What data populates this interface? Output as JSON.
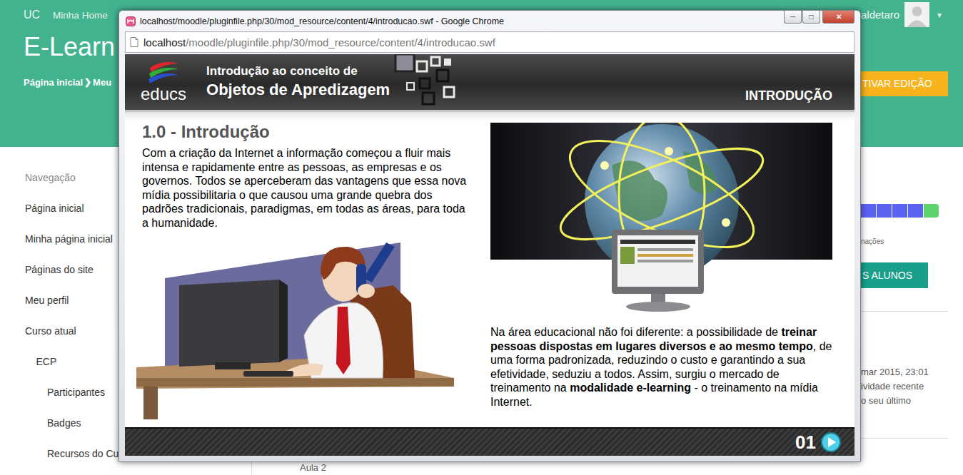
{
  "topbar": {
    "brand": "UC",
    "links": [
      "Minha Home"
    ],
    "user": "aldetaro",
    "caret": "▾"
  },
  "header": {
    "title": "E-Learn",
    "breadcrumb": [
      "Página inicial",
      "Meu"
    ],
    "separator": "❯",
    "edit_button": "TIVAR EDIÇÃO"
  },
  "navigation": {
    "title": "Navegação",
    "items": [
      {
        "label": "Página inicial",
        "depth": 0
      },
      {
        "label": "Minha página inicial",
        "depth": 0
      },
      {
        "label": "Páginas do site",
        "depth": 0
      },
      {
        "label": "Meu perfil",
        "depth": 0
      },
      {
        "label": "Curso atual",
        "depth": 0
      },
      {
        "label": "ECP",
        "depth": 1
      },
      {
        "label": "Participantes",
        "depth": 2
      },
      {
        "label": "Badges",
        "depth": 2
      },
      {
        "label": "Recursos do Cu",
        "depth": 2
      }
    ]
  },
  "course_block": {
    "progress": [
      {
        "color": "#5c62f0"
      },
      {
        "color": "#5c62f0"
      },
      {
        "color": "#5c62f0"
      },
      {
        "color": "#5c62f0"
      },
      {
        "color": "#5fd36b"
      }
    ],
    "caption": "nações",
    "button": "S ALUNOS"
  },
  "recent_activity": {
    "lines": [
      "mar 2015, 23:01",
      "ividade recente",
      "o seu último"
    ]
  },
  "main": {
    "sections": [
      "Aula 2"
    ]
  },
  "popup": {
    "title": "localhost/moodle/pluginfile.php/30/mod_resource/content/4/introducao.swf - Google Chrome",
    "controls": [
      {
        "label": "─",
        "kind": "minimize"
      },
      {
        "label": "□",
        "kind": "maximize"
      },
      {
        "label": "✕",
        "kind": "close"
      }
    ],
    "address": {
      "host": "localhost",
      "path": "/moodle/pluginfile.php/30/mod_resource/content/4/introducao.swf"
    },
    "lesson": {
      "logo": "educs",
      "subtitle": "Introdução ao conceito de",
      "title": "Objetos de Apredizagem",
      "section": "INTRODUÇÃO",
      "heading": "1.0 - Introdução",
      "paragraph": "Com a criação da Internet a informação começou a fluir mais intensa e rapidamente entre as pessoas, as empresas e os governos. Todos se aperceberam das vantagens que essa nova mídia possibilitaria o que causou uma grande quebra dos padrões tradicionais, paradigmas, em todas as áreas, para toda a humanidade.",
      "segments": [
        {
          "text": "Na área educacional não foi diferente: a possibilidade de ",
          "bold": false
        },
        {
          "text": "treinar pessoas dispostas em lugares diversos e ao mesmo tempo",
          "bold": true
        },
        {
          "text": ", de uma forma padronizada, reduzindo o custo e garantindo a sua efetividade, seduziu a todos. Assim, surgiu o mercado de treinamento na ",
          "bold": false
        },
        {
          "text": "modalidade e-learning",
          "bold": true
        },
        {
          "text": " - o treinamento na mídia Internet.",
          "bold": false
        }
      ],
      "page": "01"
    }
  }
}
